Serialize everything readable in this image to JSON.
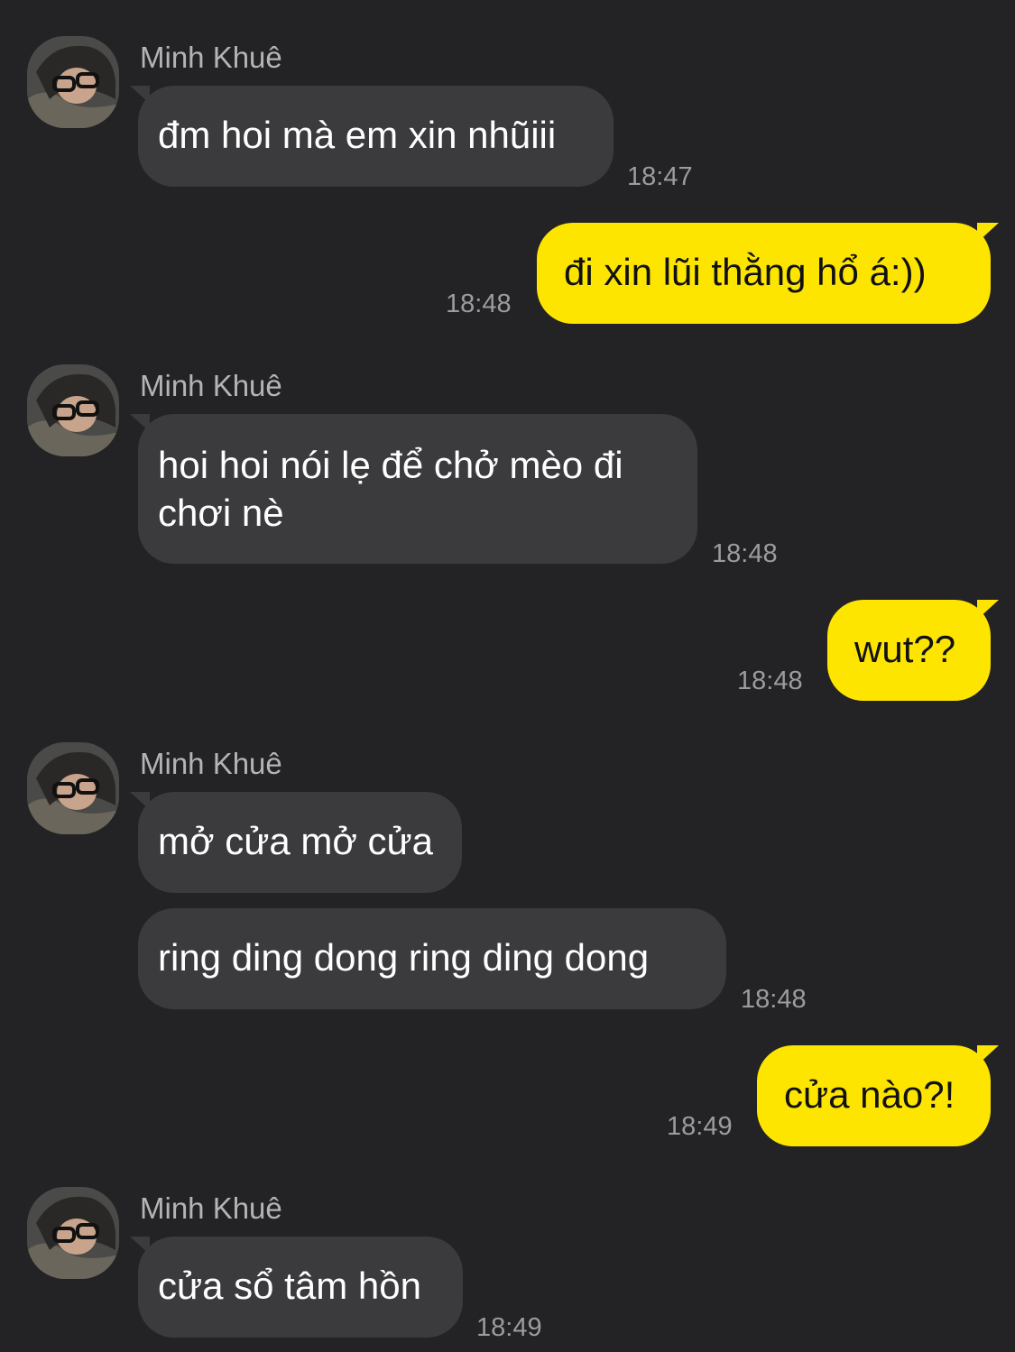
{
  "contact": {
    "name": "Minh Khuê",
    "avatar_icon": "profile-photo-avatar"
  },
  "colors": {
    "background": "#232325",
    "incoming_bubble": "#3b3b3e",
    "outgoing_bubble": "#fee500"
  },
  "messages": [
    {
      "sender": "Minh Khuê",
      "direction": "incoming",
      "text": "đm hoi mà em xin nhũiii",
      "time": "18:47"
    },
    {
      "sender": "me",
      "direction": "outgoing",
      "text": "đi xin lũi thằng hổ á:))",
      "time": "18:48"
    },
    {
      "sender": "Minh Khuê",
      "direction": "incoming",
      "lines": [
        "hoi hoi nói lẹ để chở mèo đi",
        "chơi nè"
      ],
      "time": "18:48"
    },
    {
      "sender": "me",
      "direction": "outgoing",
      "text": "wut??",
      "time": "18:48"
    },
    {
      "sender": "Minh Khuê",
      "direction": "incoming",
      "text": "mở cửa mở cửa"
    },
    {
      "sender": "Minh Khuê",
      "direction": "incoming",
      "text": "ring ding dong ring ding dong",
      "time": "18:48"
    },
    {
      "sender": "me",
      "direction": "outgoing",
      "text": "cửa nào?!",
      "time": "18:49"
    },
    {
      "sender": "Minh Khuê",
      "direction": "incoming",
      "text": "cửa sổ tâm hồn",
      "time": "18:49"
    }
  ]
}
